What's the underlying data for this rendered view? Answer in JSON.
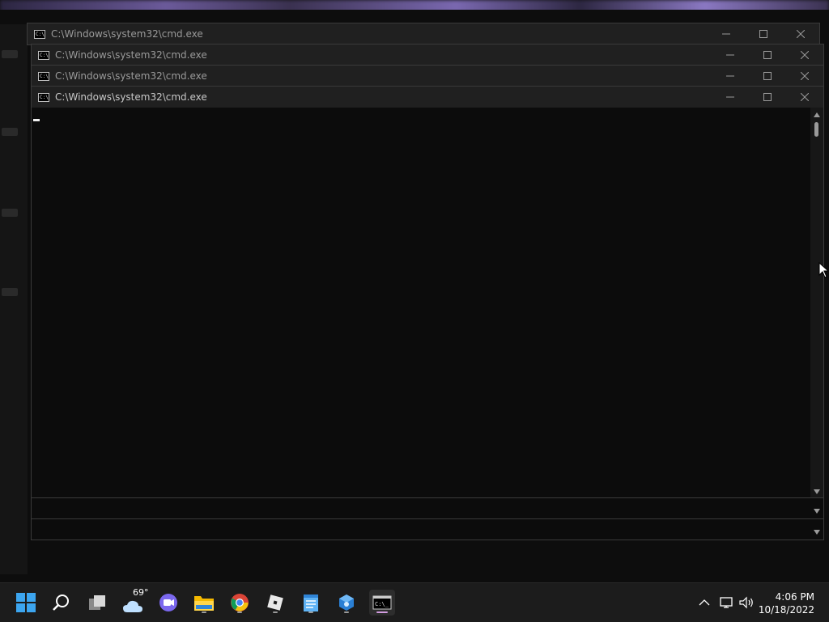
{
  "windows": [
    {
      "title": "C:\\Windows\\system32\\cmd.exe"
    },
    {
      "title": "C:\\Windows\\system32\\cmd.exe"
    },
    {
      "title": "C:\\Windows\\system32\\cmd.exe"
    },
    {
      "title": "C:\\Windows\\system32\\cmd.exe"
    }
  ],
  "icons": {
    "app": "cmd-icon",
    "minimize": "minimize-icon",
    "maximize": "maximize-icon",
    "close": "close-icon"
  },
  "taskbar": {
    "weather_temp": "69°",
    "time": "4:06 PM",
    "date": "10/18/2022",
    "items": [
      {
        "name": "start"
      },
      {
        "name": "search"
      },
      {
        "name": "task-view"
      },
      {
        "name": "weather"
      },
      {
        "name": "teams-chat"
      },
      {
        "name": "file-explorer"
      },
      {
        "name": "chrome"
      },
      {
        "name": "roblox"
      },
      {
        "name": "notepad"
      },
      {
        "name": "blue-app"
      },
      {
        "name": "command-prompt"
      }
    ]
  },
  "colors": {
    "console_bg": "#0c0c0c",
    "titlebar_bg": "#202020",
    "taskbar_bg": "#1c1c1c",
    "active_indicator": "#d29ce0"
  }
}
